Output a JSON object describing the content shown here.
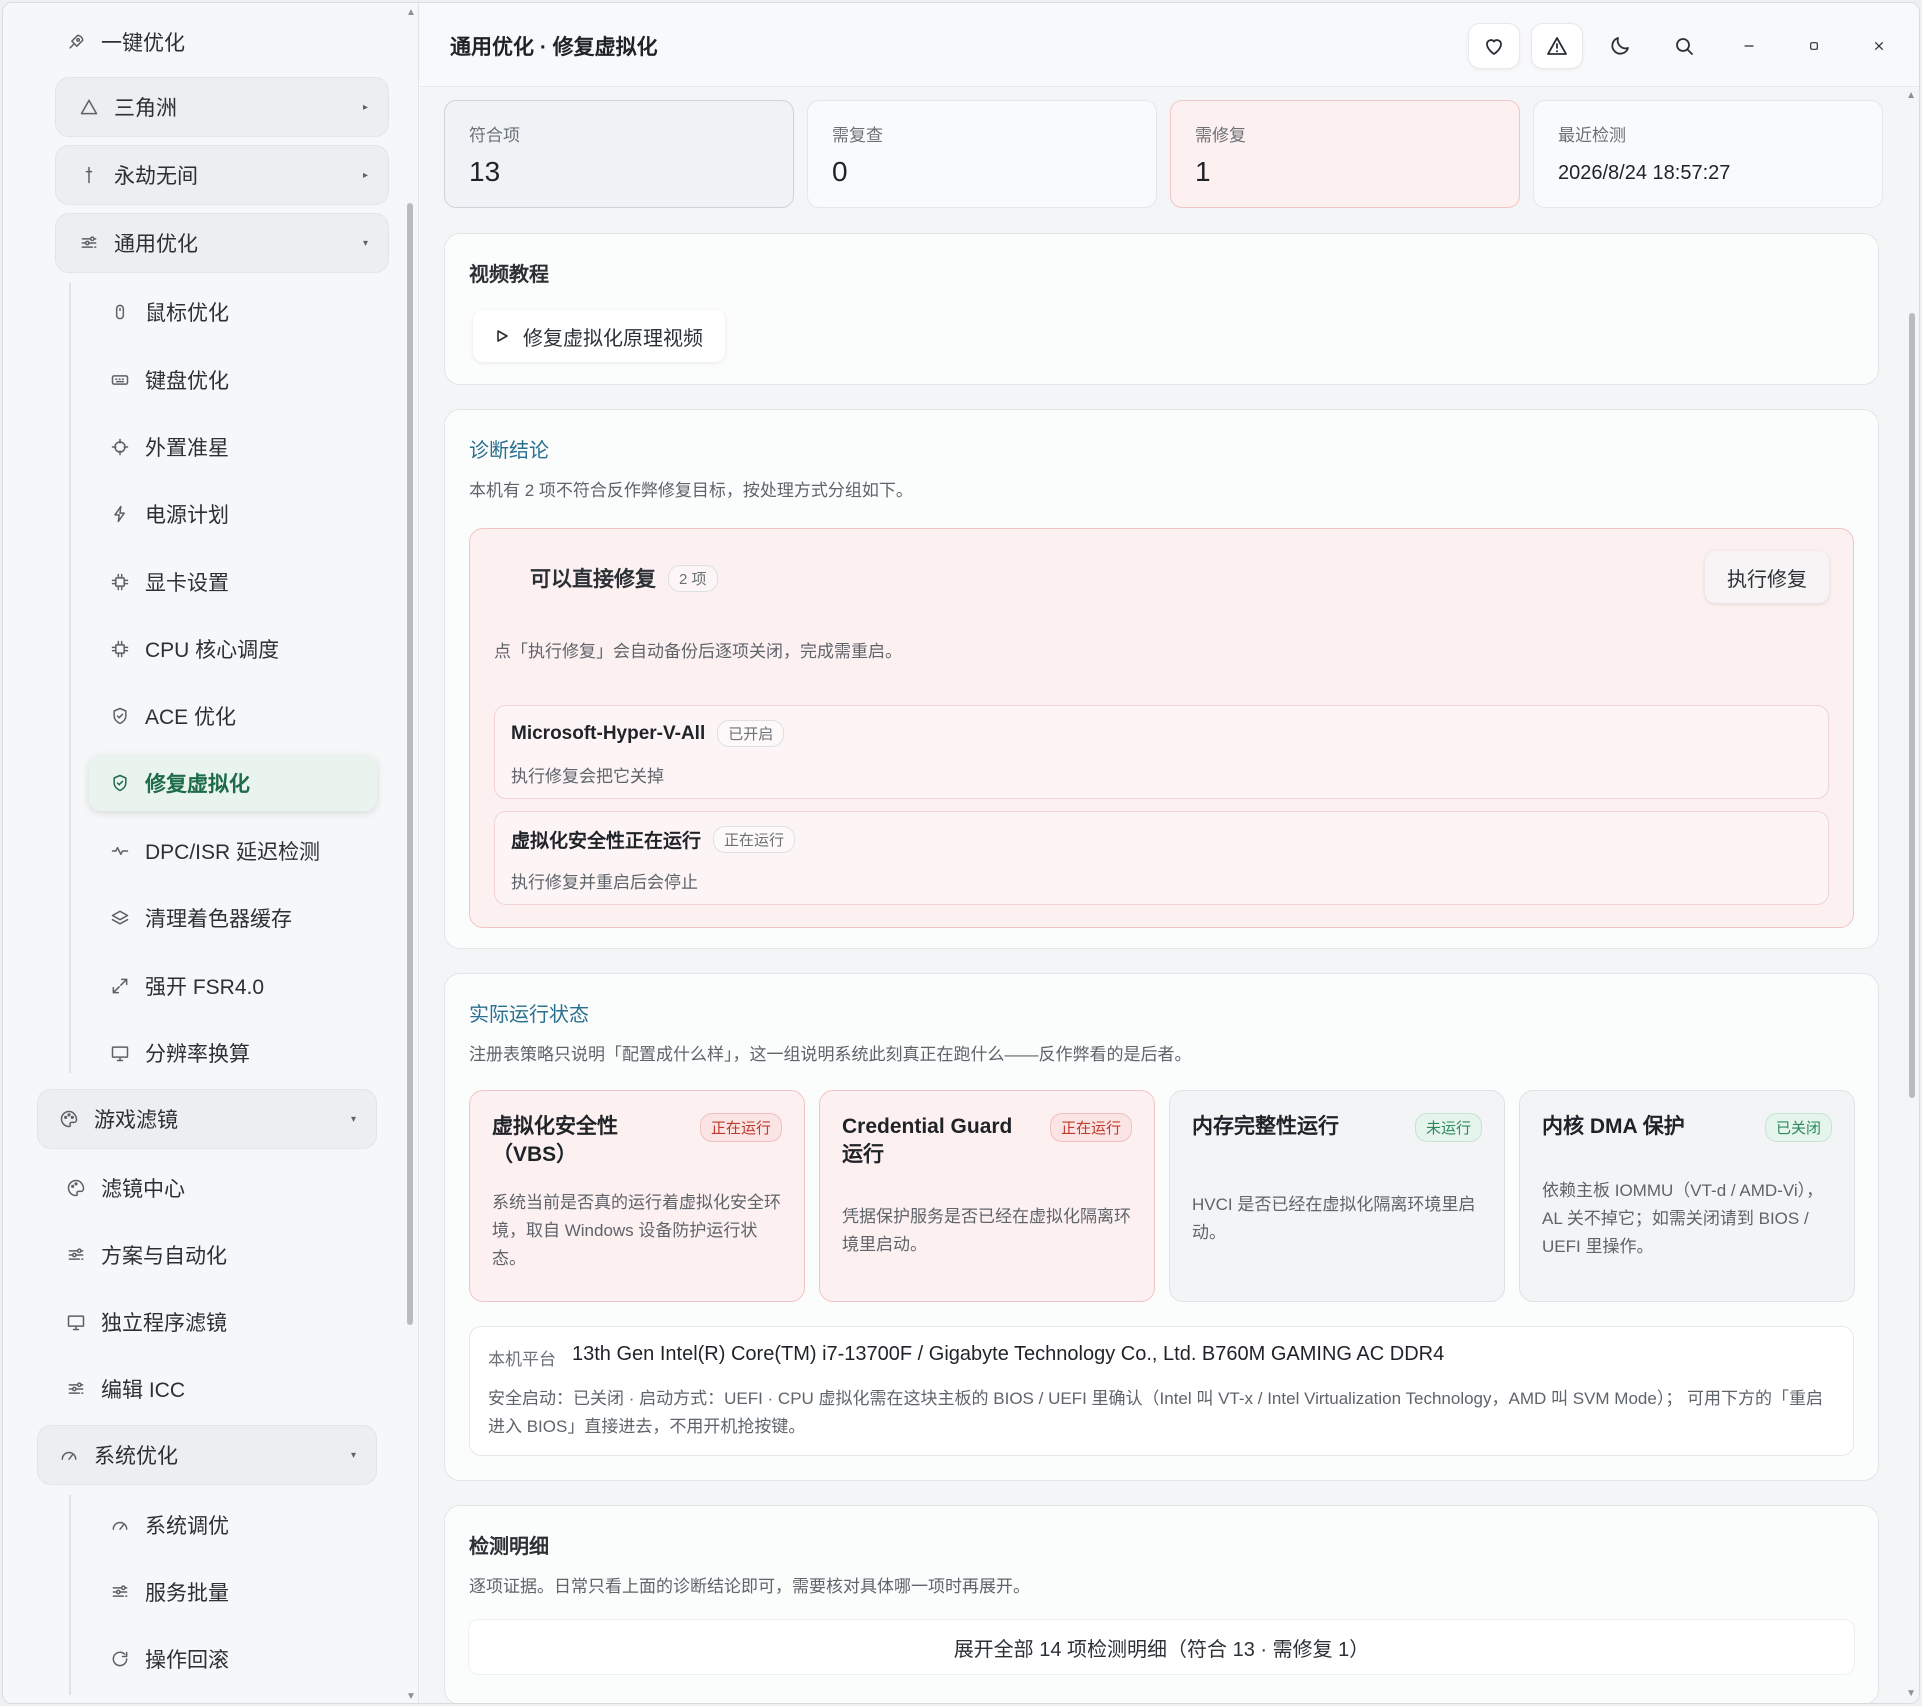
{
  "sidebar": {
    "top_item": "一键优化",
    "groups": [
      {
        "label": "三角洲"
      },
      {
        "label": "永劫无间"
      },
      {
        "label": "通用优化"
      }
    ],
    "general_items": [
      {
        "label": "鼠标优化"
      },
      {
        "label": "键盘优化"
      },
      {
        "label": "外置准星"
      },
      {
        "label": "电源计划"
      },
      {
        "label": "显卡设置"
      },
      {
        "label": "CPU 核心调度"
      },
      {
        "label": "ACE 优化"
      },
      {
        "label": "修复虚拟化"
      },
      {
        "label": "DPC/ISR 延迟检测"
      },
      {
        "label": "清理着色器缓存"
      },
      {
        "label": "强开 FSR4.0"
      },
      {
        "label": "分辨率换算"
      }
    ],
    "filter_group": "游戏滤镜",
    "filter_items": [
      {
        "label": "滤镜中心"
      },
      {
        "label": "方案与自动化"
      },
      {
        "label": "独立程序滤镜"
      },
      {
        "label": "编辑 ICC"
      }
    ],
    "system_group": "系统优化",
    "system_items": [
      {
        "label": "系统调优"
      },
      {
        "label": "服务批量"
      },
      {
        "label": "操作回滚"
      }
    ]
  },
  "header": {
    "breadcrumb": "通用优化 · 修复虚拟化",
    "buttons": [
      "heart-icon",
      "warning-icon",
      "moon-icon",
      "search-icon",
      "minimize-icon",
      "maximize-icon",
      "close-icon"
    ]
  },
  "stats": [
    {
      "label": "符合项",
      "value": "13"
    },
    {
      "label": "需复查",
      "value": "0"
    },
    {
      "label": "需修复",
      "value": "1"
    },
    {
      "label": "最近检测",
      "value": "2026/8/24 18:57:27"
    }
  ],
  "video": {
    "title": "视频教程",
    "button": "修复虚拟化原理视频"
  },
  "diagnosis": {
    "title": "诊断结论",
    "desc": "本机有 2 项不符合反作弊修复目标，按处理方式分组如下。",
    "fix_group": {
      "title": "可以直接修复",
      "count": "2 项",
      "exec_button": "执行修复",
      "note": "点「执行修复」会自动备份后逐项关闭，完成需重启。",
      "items": [
        {
          "name": "Microsoft-Hyper-V-All",
          "tag": "已开启",
          "desc": "执行修复会把它关掉"
        },
        {
          "name": "虚拟化安全性正在运行",
          "tag": "正在运行",
          "desc": "执行修复并重启后会停止"
        }
      ]
    }
  },
  "runtime": {
    "title": "实际运行状态",
    "desc": "注册表策略只说明「配置成什么样」，这一组说明系统此刻真正在跑什么——反作弊看的是后者。",
    "cards": [
      {
        "title": "虚拟化安全性（VBS）",
        "badge": "正在运行",
        "desc": "系统当前是否真的运行着虚拟化安全环境，取自 Windows 设备防护运行状态。"
      },
      {
        "title": "Credential Guard 运行",
        "badge": "正在运行",
        "desc": "凭据保护服务是否已经在虚拟化隔离环境里启动。"
      },
      {
        "title": "内存完整性运行",
        "badge": "未运行",
        "desc": "HVCI 是否已经在虚拟化隔离环境里启动。"
      },
      {
        "title": "内核 DMA 保护",
        "badge": "已关闭",
        "desc": "依赖主板 IOMMU（VT-d / AMD-Vi），AL 关不掉它；如需关闭请到 BIOS / UEFI 里操作。"
      }
    ],
    "platform": {
      "label": "本机平台",
      "value": "13th Gen Intel(R) Core(TM) i7-13700F / Gigabyte Technology Co., Ltd. B760M GAMING AC DDR4",
      "desc": "安全启动：已关闭 · 启动方式：UEFI · CPU 虚拟化需在这块主板的 BIOS / UEFI 里确认（Intel 叫 VT-x / Intel Virtualization Technology，AMD 叫 SVM Mode）； 可用下方的「重启进入 BIOS」直接进去，不用开机抢按键。"
    }
  },
  "details": {
    "title": "检测明细",
    "desc": "逐项证据。日常只看上面的诊断结论即可，需要核对具体哪一项时再展开。",
    "expand_button": "展开全部 14 项检测明细（符合 13 · 需修复 1）"
  }
}
